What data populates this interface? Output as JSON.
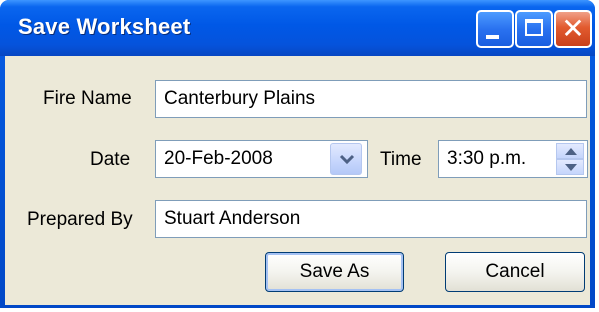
{
  "window": {
    "title": "Save Worksheet",
    "controls": {
      "minimize": "minimize-icon",
      "maximize": "maximize-icon",
      "close": "close-icon"
    }
  },
  "form": {
    "fire_name_label": "Fire Name",
    "fire_name_value": "Canterbury Plains",
    "date_label": "Date",
    "date_value": "20-Feb-2008",
    "time_label": "Time",
    "time_value": "3:30 p.m.",
    "prepared_by_label": "Prepared By",
    "prepared_by_value": "Stuart Anderson"
  },
  "buttons": {
    "save_as": "Save As",
    "cancel": "Cancel"
  },
  "colors": {
    "titlebar": "#0058e6",
    "dialog_bg": "#ece9d8",
    "field_border": "#7f9db9",
    "close_button": "#e25b2f"
  }
}
